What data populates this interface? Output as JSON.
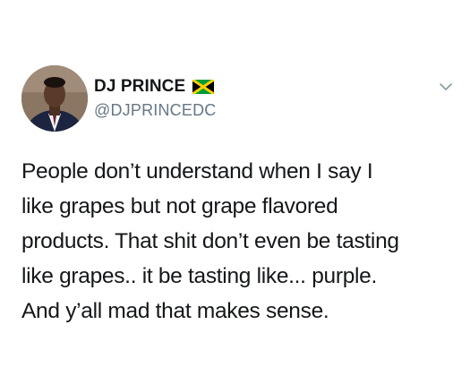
{
  "tweet": {
    "author": {
      "display_name": "DJ PRINCE",
      "handle": "@DJPRINCEDC",
      "flag_icon": "jamaica-flag-icon",
      "avatar_icon": "profile-photo"
    },
    "menu_icon": "chevron-down-icon",
    "text_lines": [
      "People don’t understand when I say I",
      "like grapes but not grape flavored",
      "products. That shit don’t even be tasting",
      "like grapes.. it be tasting like... purple.",
      "And y’all mad that makes sense."
    ]
  },
  "colors": {
    "text": "#14171a",
    "secondary": "#657786",
    "chevron": "#8899a6",
    "flag_green": "#009b3a",
    "flag_gold": "#fed100",
    "flag_black": "#000000"
  }
}
